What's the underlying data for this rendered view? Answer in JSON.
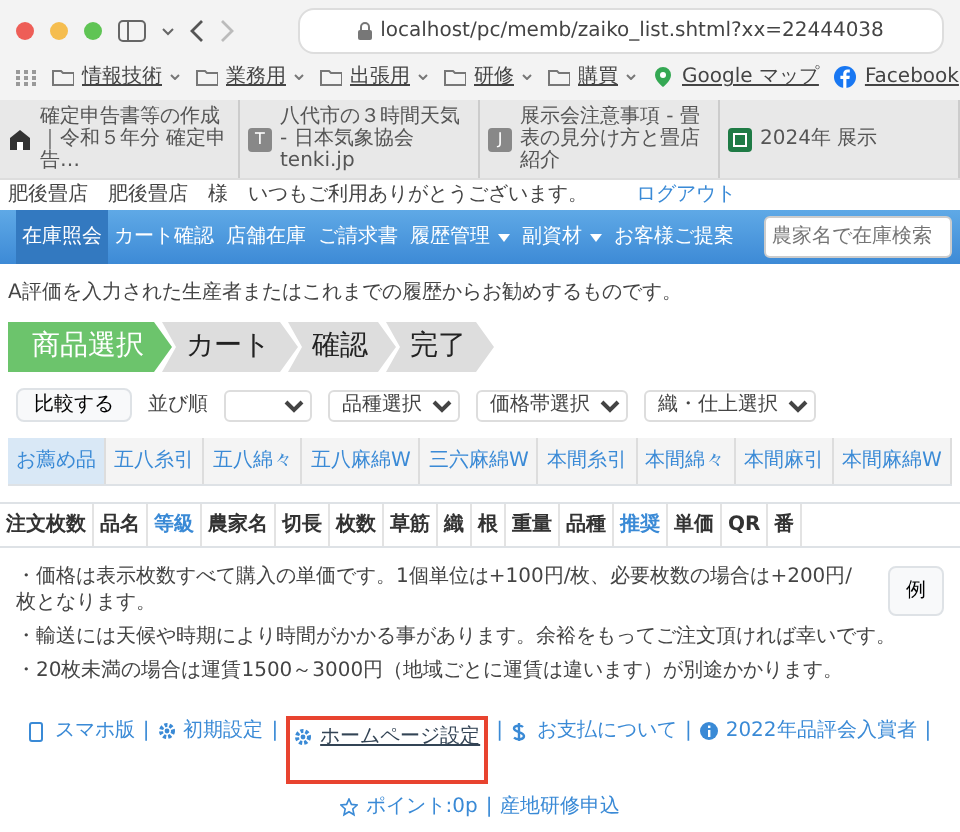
{
  "browser": {
    "address": "localhost/pc/memb/zaiko_list.shtml?xx=22444038",
    "bookmarks": [
      {
        "label": "情報技術",
        "kind": "folder"
      },
      {
        "label": "業務用",
        "kind": "folder"
      },
      {
        "label": "出張用",
        "kind": "folder"
      },
      {
        "label": "研修",
        "kind": "folder"
      },
      {
        "label": "購買",
        "kind": "folder"
      },
      {
        "label": "Google マップ",
        "kind": "map"
      },
      {
        "label": "Facebook",
        "kind": "facebook"
      }
    ],
    "tabs": [
      {
        "label": "確定申告書等の作成｜令和５年分 確定申告…",
        "kind": "site"
      },
      {
        "label": "八代市の３時間天気 - 日本気象協会 tenki.jp",
        "kind": "letter",
        "letter": "T"
      },
      {
        "label": "展示会注意事項 - 畳表の見分け方と畳店紹介",
        "kind": "letter",
        "letter": "J"
      },
      {
        "label": "2024年 展示",
        "kind": "sheet"
      }
    ]
  },
  "greeting": {
    "text": "肥後畳店　肥後畳店　様　いつもご利用ありがとうございます。",
    "logout": "ログアウト"
  },
  "navbar": {
    "items": [
      {
        "label": "在庫照会",
        "selected": true,
        "dropdown": false
      },
      {
        "label": "カート確認",
        "selected": false,
        "dropdown": false
      },
      {
        "label": "店舗在庫",
        "selected": false,
        "dropdown": false
      },
      {
        "label": "ご請求書",
        "selected": false,
        "dropdown": false
      },
      {
        "label": "履歴管理",
        "selected": false,
        "dropdown": true
      },
      {
        "label": "副資材",
        "selected": false,
        "dropdown": true
      },
      {
        "label": "お客様ご提案",
        "selected": false,
        "dropdown": false
      }
    ],
    "search": {
      "placeholder": "農家名で在庫検索"
    }
  },
  "intro": "A評価を入力された生産者またはこれまでの履歴からお勧めするものです。",
  "steps": [
    {
      "label": "商品選択",
      "selected": true
    },
    {
      "label": "カート",
      "selected": false
    },
    {
      "label": "確認",
      "selected": false
    },
    {
      "label": "完了",
      "selected": false
    }
  ],
  "toolbar": {
    "compare_button": "比較する",
    "sort_label": "並び順",
    "filters": [
      "品種選択",
      "価格帯選択",
      "織・仕上選択"
    ]
  },
  "categories": [
    {
      "label": "お薦め品",
      "selected": true
    },
    {
      "label": "五八糸引",
      "selected": false
    },
    {
      "label": "五八綿々",
      "selected": false
    },
    {
      "label": "五八麻綿W",
      "selected": false
    },
    {
      "label": "三六麻綿W",
      "selected": false
    },
    {
      "label": "本間糸引",
      "selected": false
    },
    {
      "label": "本間綿々",
      "selected": false
    },
    {
      "label": "本間麻引",
      "selected": false
    },
    {
      "label": "本間麻綿W",
      "selected": false
    }
  ],
  "table": {
    "columns": [
      {
        "label": "注文枚数",
        "sortable": false
      },
      {
        "label": "品名",
        "sortable": false
      },
      {
        "label": "等級",
        "sortable": true
      },
      {
        "label": "農家名",
        "sortable": false
      },
      {
        "label": "切長",
        "sortable": false
      },
      {
        "label": "枚数",
        "sortable": false
      },
      {
        "label": "草筋",
        "sortable": false
      },
      {
        "label": "織",
        "sortable": false
      },
      {
        "label": "根",
        "sortable": false
      },
      {
        "label": "重量",
        "sortable": false
      },
      {
        "label": "品種",
        "sortable": false
      },
      {
        "label": "推奨",
        "sortable": true
      },
      {
        "label": "単価",
        "sortable": false
      },
      {
        "label": "QR",
        "sortable": false
      },
      {
        "label": "番",
        "sortable": false
      }
    ]
  },
  "notes": [
    {
      "text": "・価格は表示枚数すべて購入の単価です。1個単位は+100円/枚、必要枚数の場合は+200円/枚となります。",
      "button": "例"
    },
    {
      "text": "・輸送には天候や時期により時間がかかる事があります。余裕をもってご注文頂ければ幸いです。"
    },
    {
      "text": "・20枚未満の場合は運賃1500～3000円（地域ごとに運賃は違います）が別途かかります。"
    }
  ],
  "footer_separator": "|",
  "footer_links": [
    {
      "label": "スマホ版",
      "kind": "phone",
      "highlighted": false
    },
    {
      "label": "初期設定",
      "kind": "gear",
      "highlighted": false
    },
    {
      "label": "ホームページ設定",
      "kind": "gear",
      "highlighted": true
    },
    {
      "label": "お支払について",
      "kind": "dollar",
      "highlighted": false
    },
    {
      "label": "2022年品評会入賞者",
      "kind": "info",
      "highlighted": false
    },
    {
      "label": "ポイント:0p",
      "kind": "star",
      "highlighted": false
    },
    {
      "label": "産地研修申込",
      "kind": "plain",
      "highlighted": false
    }
  ]
}
